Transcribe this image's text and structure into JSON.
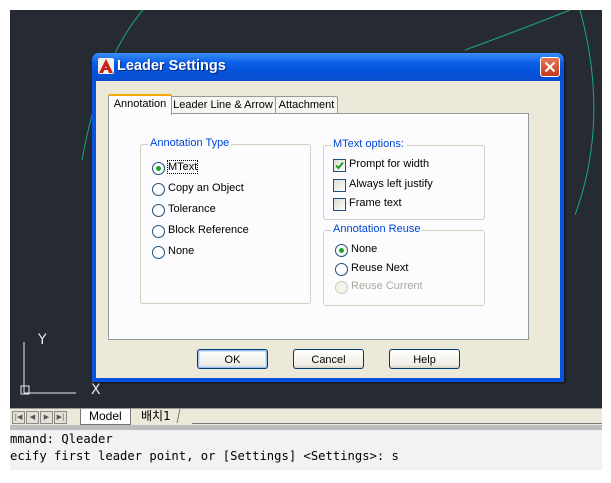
{
  "app": {
    "ucs_y": "Y",
    "ucs_x": "X"
  },
  "layout_tabs": {
    "model": "Model",
    "layout1": "배치1"
  },
  "command_line": {
    "line1": "mmand: Qleader",
    "line2": "ecify first leader point, or [Settings] <Settings>: s"
  },
  "dialog": {
    "title": "Leader Settings",
    "close_icon": "close-icon",
    "tabs": [
      {
        "label": "Annotation",
        "active": true
      },
      {
        "label": "Leader Line & Arrow",
        "active": false
      },
      {
        "label": "Attachment",
        "active": false
      }
    ],
    "annotation_type": {
      "title": "Annotation Type",
      "options": [
        {
          "label": "MText",
          "selected": true
        },
        {
          "label": "Copy an Object",
          "selected": false
        },
        {
          "label": "Tolerance",
          "selected": false
        },
        {
          "label": "Block Reference",
          "selected": false
        },
        {
          "label": "None",
          "selected": false
        }
      ]
    },
    "mtext_options": {
      "title": "MText options:",
      "options": [
        {
          "label": "Prompt for width",
          "checked": true
        },
        {
          "label": "Always left justify",
          "checked": false
        },
        {
          "label": "Frame text",
          "checked": false
        }
      ]
    },
    "annotation_reuse": {
      "title": "Annotation Reuse",
      "options": [
        {
          "label": "None",
          "selected": true,
          "enabled": true
        },
        {
          "label": "Reuse Next",
          "selected": false,
          "enabled": true
        },
        {
          "label": "Reuse Current",
          "selected": false,
          "enabled": false
        }
      ]
    },
    "buttons": {
      "ok": "OK",
      "cancel": "Cancel",
      "help": "Help"
    }
  },
  "colors": {
    "viewport_bg": "#262b33",
    "drawing_line": "#1aa87a",
    "dialog_frame": "#0854e0",
    "group_title": "#0046d5"
  }
}
